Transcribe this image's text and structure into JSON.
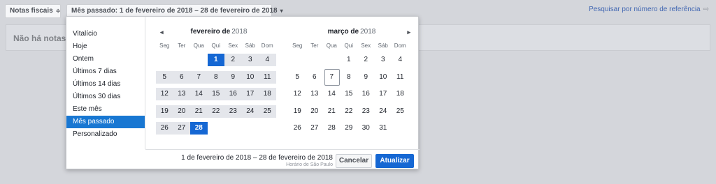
{
  "toolbar": {
    "notas_label": "Notas fiscais",
    "notas_caret": "≑",
    "period_label": "Mês passado: 1 de fevereiro de 2018 – 28 de fevereiro de 2018",
    "period_caret": "▾",
    "search_ref_link": "Pesquisar por número de referência",
    "search_ref_icon": "⇨"
  },
  "main": {
    "empty_message": "Não há notas"
  },
  "presets": [
    {
      "label": "Vitalício"
    },
    {
      "label": "Hoje"
    },
    {
      "label": "Ontem"
    },
    {
      "label": "Últimos 7 dias"
    },
    {
      "label": "Últimos 14 dias"
    },
    {
      "label": "Últimos 30 dias"
    },
    {
      "label": "Este mês"
    },
    {
      "label": "Mês passado",
      "active": true
    },
    {
      "label": "Personalizado"
    }
  ],
  "weekdays": [
    "Seg",
    "Ter",
    "Qua",
    "Qui",
    "Sex",
    "Sáb",
    "Dom"
  ],
  "calendars": [
    {
      "month": "fevereiro de",
      "year": "2018",
      "nav": "◂",
      "weeks": [
        [
          "",
          "",
          "",
          "1",
          "2",
          "3",
          "4"
        ],
        [
          "5",
          "6",
          "7",
          "8",
          "9",
          "10",
          "11"
        ],
        [
          "12",
          "13",
          "14",
          "15",
          "16",
          "17",
          "18"
        ],
        [
          "19",
          "20",
          "21",
          "22",
          "23",
          "24",
          "25"
        ],
        [
          "26",
          "27",
          "28",
          "",
          "",
          "",
          ""
        ]
      ],
      "range_start": "1",
      "range_end": "28",
      "today": ""
    },
    {
      "month": "março de",
      "year": "2018",
      "nav": "▸",
      "weeks": [
        [
          "",
          "",
          "",
          "1",
          "2",
          "3",
          "4"
        ],
        [
          "5",
          "6",
          "7",
          "8",
          "9",
          "10",
          "11"
        ],
        [
          "12",
          "13",
          "14",
          "15",
          "16",
          "17",
          "18"
        ],
        [
          "19",
          "20",
          "21",
          "22",
          "23",
          "24",
          "25"
        ],
        [
          "26",
          "27",
          "28",
          "29",
          "30",
          "31",
          ""
        ]
      ],
      "range_start": "",
      "range_end": "",
      "today": "7"
    }
  ],
  "footer": {
    "range_text": "1 de fevereiro de 2018 – 28 de fevereiro de 2018",
    "timezone": "Horário de São Paulo",
    "cancel_label": "Cancelar",
    "update_label": "Atualizar"
  },
  "colors": {
    "accent": "#1567d3",
    "range_fill": "#e4e6eb",
    "link": "#4267b2"
  }
}
